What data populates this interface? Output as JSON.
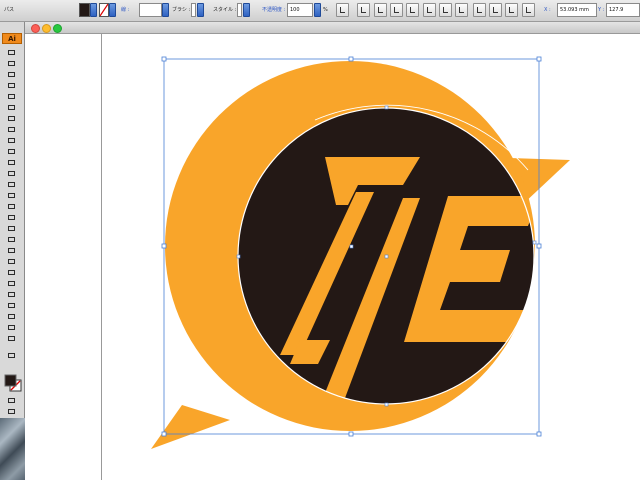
{
  "control_bar": {
    "path_label": "パス",
    "stroke_label": "線 :",
    "brush_label": "ブラシ :",
    "style_label": "スタイル :",
    "opacity_label": "不透明度 :",
    "opacity_value": "100",
    "opacity_unit": "%",
    "x_label": "X :",
    "x_value": "53.093 mm",
    "y_label": "Y :",
    "y_value": "127.9",
    "fill_color": "#231815"
  },
  "toolbox": {
    "logo": "Ai"
  },
  "artwork": {
    "orange": "#f9a52a",
    "dark": "#231815",
    "selection_color": "#4a7fd6"
  }
}
